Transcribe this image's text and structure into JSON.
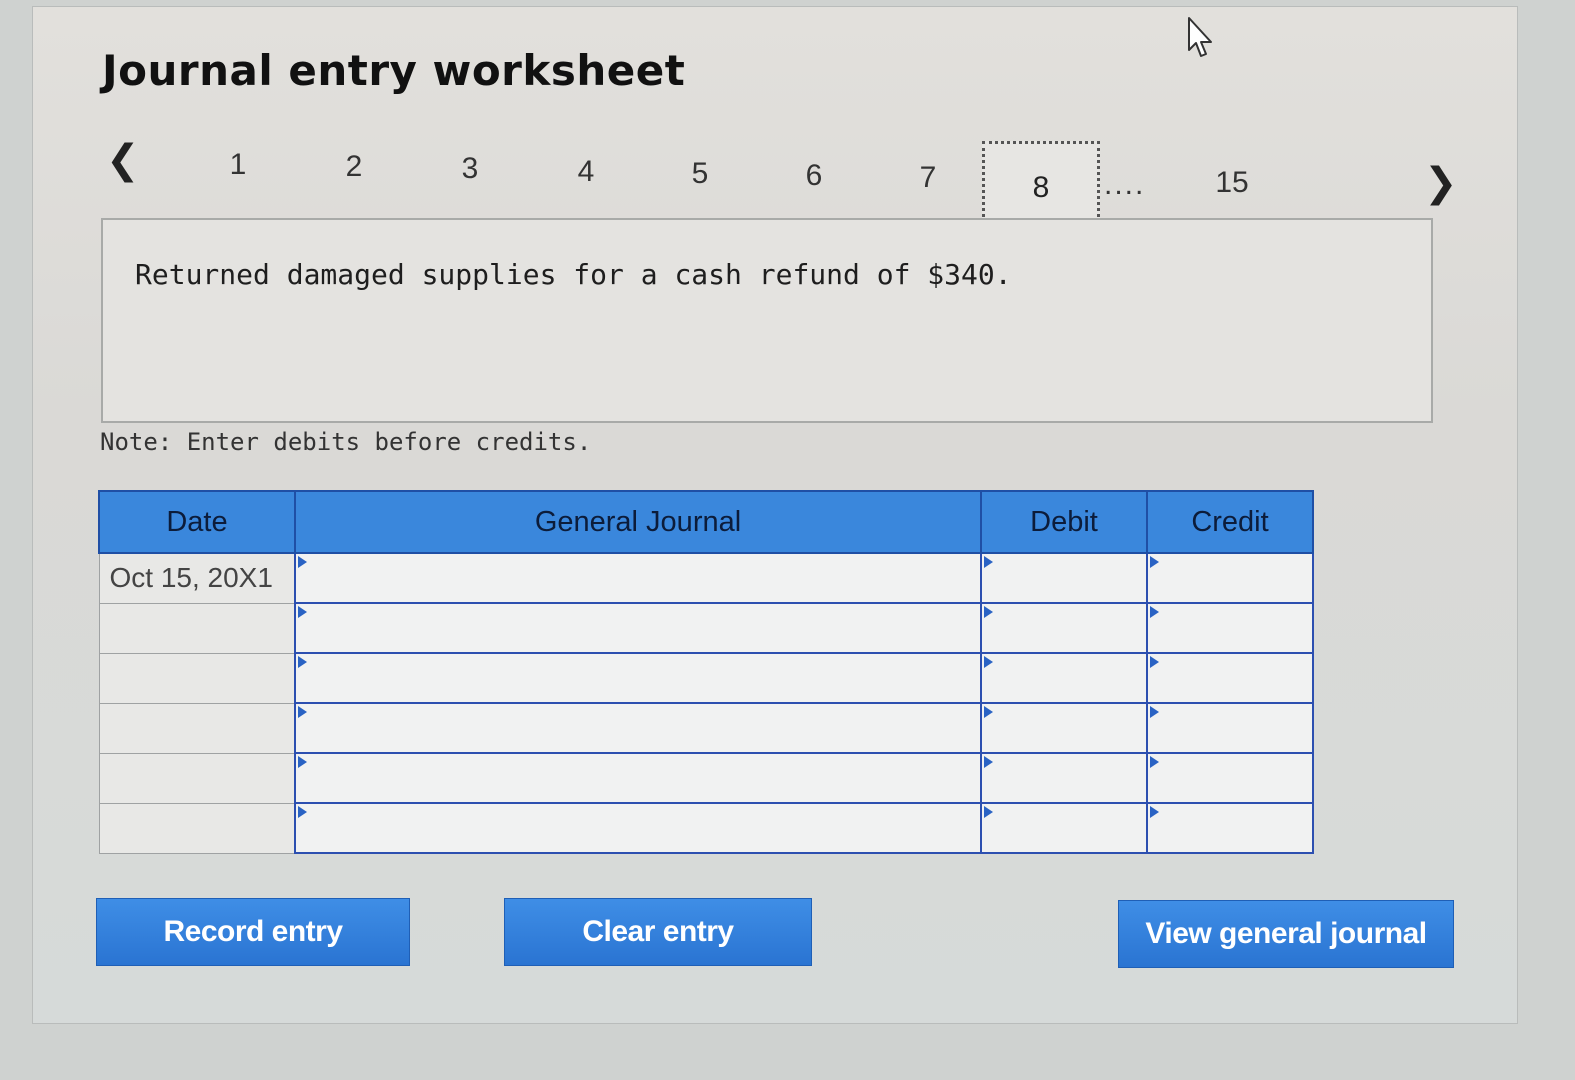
{
  "worksheet": {
    "title": "Journal entry worksheet",
    "pagination": {
      "prev_icon": "chevron-left-icon",
      "pages": [
        "1",
        "2",
        "3",
        "4",
        "5",
        "6",
        "7"
      ],
      "current_page": "8",
      "ellipsis": "....",
      "last_page": "15",
      "next_icon": "chevron-right-icon"
    },
    "question": "Returned damaged supplies for a cash refund of $340.",
    "note": "Note: Enter debits before credits."
  },
  "journal_table": {
    "headers": {
      "date": "Date",
      "general_journal": "General Journal",
      "debit": "Debit",
      "credit": "Credit"
    },
    "rows": [
      {
        "date": "Oct 15, 20X1",
        "account": "",
        "debit": "",
        "credit": ""
      },
      {
        "date": "",
        "account": "",
        "debit": "",
        "credit": ""
      },
      {
        "date": "",
        "account": "",
        "debit": "",
        "credit": ""
      },
      {
        "date": "",
        "account": "",
        "debit": "",
        "credit": ""
      },
      {
        "date": "",
        "account": "",
        "debit": "",
        "credit": ""
      },
      {
        "date": "",
        "account": "",
        "debit": "",
        "credit": ""
      }
    ]
  },
  "buttons": {
    "record": "Record entry",
    "clear": "Clear entry",
    "view": "View general journal"
  },
  "colors": {
    "header_blue": "#3a87dc",
    "button_blue": "#2a74d2",
    "grid_border": "#2c4fb0"
  },
  "cursor_icon": "mouse-pointer-icon"
}
